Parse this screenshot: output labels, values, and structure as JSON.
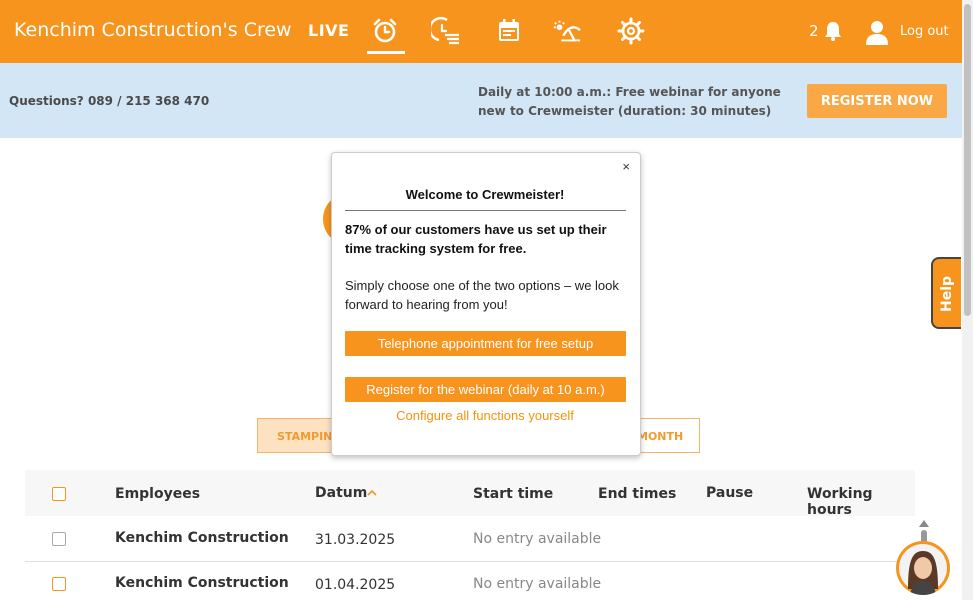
{
  "header": {
    "company_title": "Kenchim Construction's Crew",
    "live_label": "LIVE",
    "nav_icons": [
      "alarm-clock-icon",
      "time-list-icon",
      "calendar-icon",
      "vacation-icon",
      "gear-icon"
    ],
    "notification_count": "2",
    "logout_label": "Log out",
    "accent_color": "#f7941d"
  },
  "infobar": {
    "questions": "Questions? 089 / 215 368 470",
    "webinar_note": "Daily at 10:00 a.m.: Free webinar for anyone new to Crewmeister (duration: 30 minutes)",
    "register_label": "REGISTER NOW"
  },
  "filters": {
    "stamping_label": "STAMPING",
    "month_label": "MONTH"
  },
  "help_label": "Help",
  "table": {
    "columns": [
      "Employees",
      "Datum",
      "Start time",
      "End times",
      "Pause",
      "Working hours"
    ],
    "sorted_column": "Datum",
    "rows": [
      {
        "employee": "Kenchim Construction",
        "date": "31.03.2025",
        "status": "No entry available"
      },
      {
        "employee": "Kenchim Construction",
        "date": "01.04.2025",
        "status": "No entry available"
      }
    ]
  },
  "modal": {
    "close_label": "×",
    "title": "Welcome to Crewmeister!",
    "lead": "87% of our customers have us set up their time tracking system for free.",
    "body": "Simply choose one of the two options – we look forward to hearing from you!",
    "button_phone": "Telephone appointment for free setup",
    "button_webinar": "Register for the webinar (daily at 10 a.m.)",
    "link_configure": "Configure all functions yourself"
  }
}
